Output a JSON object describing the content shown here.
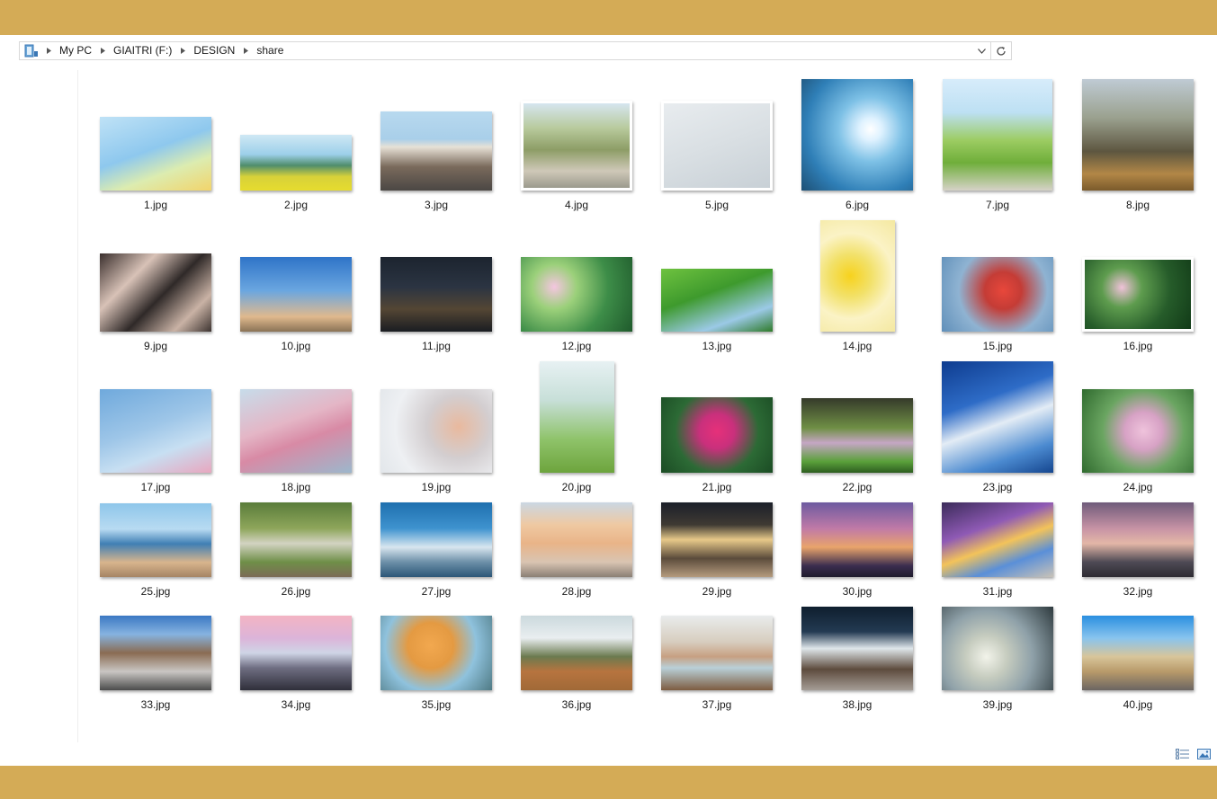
{
  "window": {
    "theme_color": "#d4ab56"
  },
  "address_bar": {
    "folder_icon": "folder-icon",
    "breadcrumbs": [
      "My PC",
      "GIAITRI (F:)",
      "DESIGN",
      "share"
    ],
    "dropdown_icon": "chevron-down-icon",
    "refresh_icon": "refresh-icon"
  },
  "view_buttons": [
    {
      "name": "details-view",
      "icon": "details-view-icon"
    },
    {
      "name": "large-icons-view",
      "icon": "large-icons-view-icon"
    }
  ],
  "files": [
    {
      "name": "1.jpg"
    },
    {
      "name": "2.jpg"
    },
    {
      "name": "3.jpg"
    },
    {
      "name": "4.jpg"
    },
    {
      "name": "5.jpg"
    },
    {
      "name": "6.jpg"
    },
    {
      "name": "7.jpg"
    },
    {
      "name": "8.jpg"
    },
    {
      "name": "9.jpg"
    },
    {
      "name": "10.jpg"
    },
    {
      "name": "11.jpg"
    },
    {
      "name": "12.jpg"
    },
    {
      "name": "13.jpg"
    },
    {
      "name": "14.jpg"
    },
    {
      "name": "15.jpg"
    },
    {
      "name": "16.jpg"
    },
    {
      "name": "17.jpg"
    },
    {
      "name": "18.jpg"
    },
    {
      "name": "19.jpg"
    },
    {
      "name": "20.jpg"
    },
    {
      "name": "21.jpg"
    },
    {
      "name": "22.jpg"
    },
    {
      "name": "23.jpg"
    },
    {
      "name": "24.jpg"
    },
    {
      "name": "25.jpg"
    },
    {
      "name": "26.jpg"
    },
    {
      "name": "27.jpg"
    },
    {
      "name": "28.jpg"
    },
    {
      "name": "29.jpg"
    },
    {
      "name": "30.jpg"
    },
    {
      "name": "31.jpg"
    },
    {
      "name": "32.jpg"
    },
    {
      "name": "33.jpg"
    },
    {
      "name": "34.jpg"
    },
    {
      "name": "35.jpg"
    },
    {
      "name": "36.jpg"
    },
    {
      "name": "37.jpg"
    },
    {
      "name": "38.jpg"
    },
    {
      "name": "39.jpg"
    },
    {
      "name": "40.jpg"
    }
  ]
}
